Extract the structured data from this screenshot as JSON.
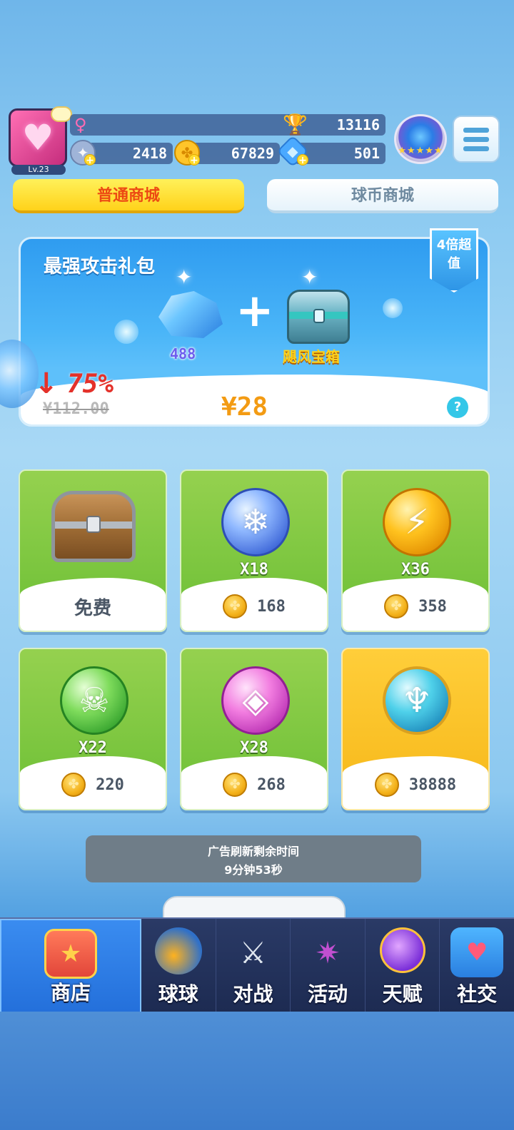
{
  "player": {
    "level": "Lv.23",
    "trophies": "13116",
    "stamina": "2418",
    "coins": "67829",
    "gems": "501"
  },
  "tabs": {
    "normal": "普通商城",
    "ballcoin": "球币商城"
  },
  "promo": {
    "title": "最强攻击礼包",
    "multiplier_tag": "4倍超值",
    "crystal_qty": "488",
    "chest_name": "飓风宝箱",
    "discount": "75%",
    "original_price": "¥112.00",
    "price": "¥28",
    "help": "?"
  },
  "items": [
    {
      "qty": "",
      "price": "",
      "free_label": "免费",
      "icon": "wooden-chest-icon"
    },
    {
      "qty": "X18",
      "price": "168",
      "icon": "snowflake-ball-icon"
    },
    {
      "qty": "X36",
      "price": "358",
      "icon": "lightning-ball-icon"
    },
    {
      "qty": "X22",
      "price": "220",
      "icon": "poison-skull-ball-icon"
    },
    {
      "qty": "X28",
      "price": "268",
      "icon": "pink-crystal-ball-icon"
    },
    {
      "qty": "",
      "price": "38888",
      "icon": "aqua-trident-ball-icon"
    }
  ],
  "timer": {
    "line1": "广告刷新剩余时间",
    "line2": "9分钟53秒"
  },
  "nav": [
    {
      "label": "商店",
      "icon": "shop-icon",
      "active": true
    },
    {
      "label": "球球",
      "icon": "balls-icon"
    },
    {
      "label": "对战",
      "icon": "crossed-swords-icon"
    },
    {
      "label": "活动",
      "icon": "party-popper-icon"
    },
    {
      "label": "天赋",
      "icon": "planet-icon"
    },
    {
      "label": "社交",
      "icon": "chat-heart-icon"
    }
  ],
  "colors": {
    "accent_yellow": "#ffd21a",
    "price_orange": "#f39b13",
    "discount_red": "#e4312a",
    "nav_active": "#2e7fe6"
  }
}
